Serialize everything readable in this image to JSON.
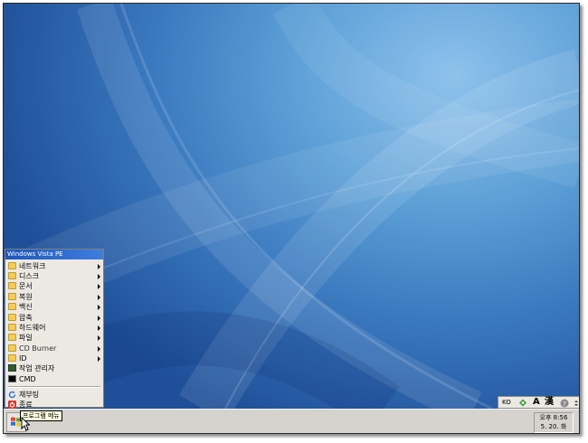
{
  "start_menu": {
    "title": "Windows Vista PE",
    "items": [
      {
        "label": "네트워크",
        "submenu": true,
        "icon": "folder-icon"
      },
      {
        "label": "디스크",
        "submenu": true,
        "icon": "folder-icon"
      },
      {
        "label": "문서",
        "submenu": true,
        "icon": "folder-icon"
      },
      {
        "label": "복원",
        "submenu": true,
        "icon": "folder-icon"
      },
      {
        "label": "백신",
        "submenu": true,
        "icon": "folder-icon"
      },
      {
        "label": "압축",
        "submenu": true,
        "icon": "folder-icon"
      },
      {
        "label": "하드웨어",
        "submenu": true,
        "icon": "folder-icon"
      },
      {
        "label": "파일",
        "submenu": true,
        "icon": "folder-icon"
      },
      {
        "label": "CD Burner",
        "submenu": true,
        "icon": "folder-icon"
      },
      {
        "label": "ID",
        "submenu": true,
        "icon": "folder-icon"
      },
      {
        "label": "작업 관리자",
        "submenu": false,
        "icon": "task-manager-icon"
      },
      {
        "label": "CMD",
        "submenu": false,
        "icon": "cmd-icon"
      }
    ],
    "power": [
      {
        "label": "재부팅",
        "icon": "restart-icon"
      },
      {
        "label": "종료",
        "icon": "shutdown-icon"
      }
    ]
  },
  "taskbar": {
    "tooltip": "프로그램 메뉴",
    "clock_time": "오후 8:56",
    "clock_date": "5. 20. 화"
  },
  "language_bar": {
    "lang": "KO",
    "mode": "A",
    "hanja": "漢",
    "icons": [
      "language-pad-icon",
      "help-icon",
      "options-icon"
    ]
  },
  "colors": {
    "desktop_light": "#8ec2ec",
    "desktop_dark": "#1e4f98",
    "menu_title": "#1f56b9",
    "taskbar": "#d6d3ce",
    "tooltip": "#ffffe1"
  }
}
